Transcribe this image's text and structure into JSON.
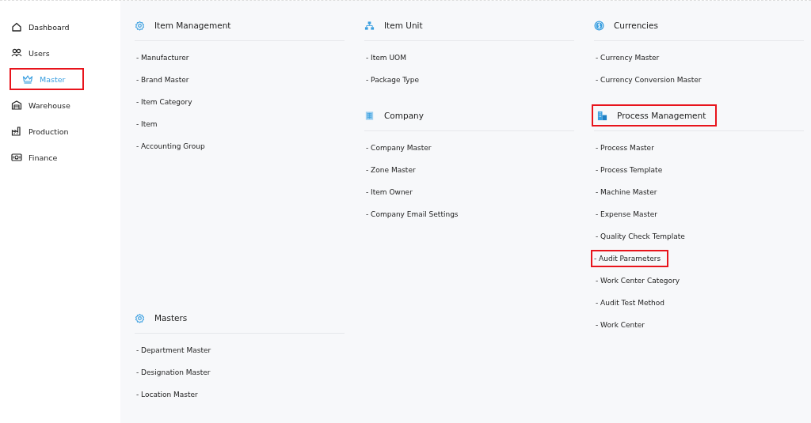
{
  "sidebar": {
    "items": [
      {
        "label": "Dashboard",
        "selected": false,
        "highlighted": false
      },
      {
        "label": "Users",
        "selected": false,
        "highlighted": false
      },
      {
        "label": "Master",
        "selected": true,
        "highlighted": true
      },
      {
        "label": "Warehouse",
        "selected": false,
        "highlighted": false
      },
      {
        "label": "Production",
        "selected": false,
        "highlighted": false
      },
      {
        "label": "Finance",
        "selected": false,
        "highlighted": false
      }
    ]
  },
  "columns": [
    {
      "sections": [
        {
          "title": "Item Management",
          "highlighted": false,
          "items": [
            {
              "label": "- Manufacturer",
              "highlighted": false
            },
            {
              "label": "- Brand Master",
              "highlighted": false
            },
            {
              "label": "- Item Category",
              "highlighted": false
            },
            {
              "label": "- Item",
              "highlighted": false
            },
            {
              "label": "- Accounting Group",
              "highlighted": false
            }
          ]
        }
      ]
    },
    {
      "sections": [
        {
          "title": "Item Unit",
          "highlighted": false,
          "items": [
            {
              "label": "- Item UOM",
              "highlighted": false
            },
            {
              "label": "- Package Type",
              "highlighted": false
            }
          ]
        },
        {
          "title": "Company",
          "highlighted": false,
          "items": [
            {
              "label": "- Company Master",
              "highlighted": false
            },
            {
              "label": "- Zone Master",
              "highlighted": false
            },
            {
              "label": "- Item Owner",
              "highlighted": false
            },
            {
              "label": "- Company Email Settings",
              "highlighted": false
            }
          ]
        }
      ]
    },
    {
      "sections": [
        {
          "title": "Currencies",
          "highlighted": false,
          "items": [
            {
              "label": "- Currency Master",
              "highlighted": false
            },
            {
              "label": "- Currency Conversion Master",
              "highlighted": false
            }
          ]
        },
        {
          "title": "Process Management",
          "highlighted": true,
          "items": [
            {
              "label": "- Process Master",
              "highlighted": false
            },
            {
              "label": "- Process Template",
              "highlighted": false
            },
            {
              "label": "- Machine Master",
              "highlighted": false
            },
            {
              "label": "- Expense Master",
              "highlighted": false
            },
            {
              "label": "- Quality Check Template",
              "highlighted": false
            },
            {
              "label": "- Audit Parameters",
              "highlighted": true
            },
            {
              "label": "- Work Center Category",
              "highlighted": false
            },
            {
              "label": "- Audit Test Method",
              "highlighted": false
            },
            {
              "label": "- Work Center",
              "highlighted": false
            }
          ]
        }
      ]
    },
    {
      "sections": [
        {
          "title": "Masters",
          "highlighted": false,
          "items": [
            {
              "label": "- Department Master",
              "highlighted": false
            },
            {
              "label": "- Designation Master",
              "highlighted": false
            },
            {
              "label": "- Location Master",
              "highlighted": false
            }
          ]
        }
      ]
    }
  ]
}
